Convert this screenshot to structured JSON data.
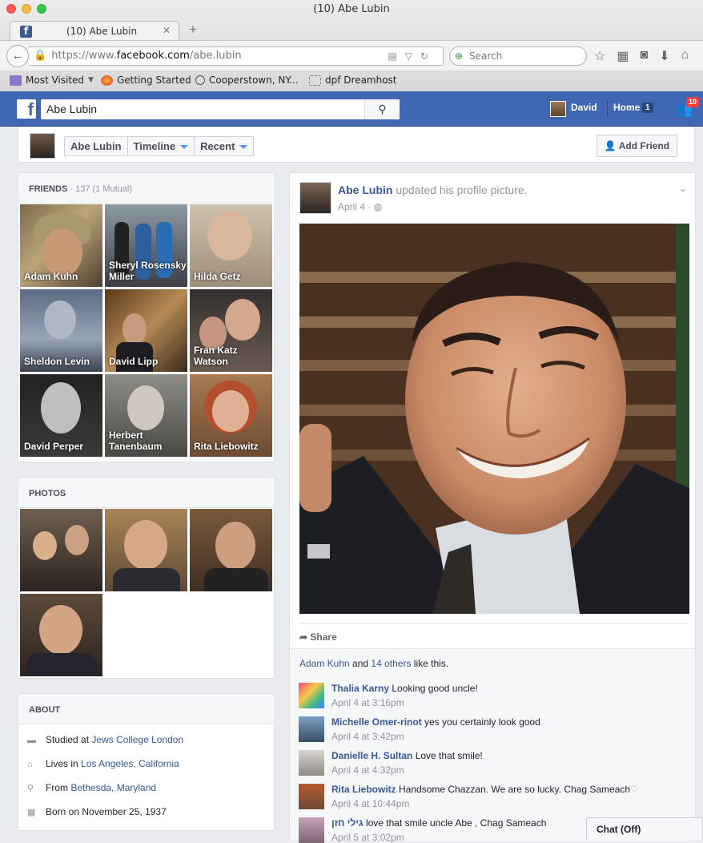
{
  "browser": {
    "window_title": "(10) Abe Lubin",
    "tab_title": "(10) Abe Lubin",
    "url_protocol": "https://www.",
    "url_domain": "facebook.com",
    "url_path": "/abe.lubin",
    "search_placeholder": "Search",
    "bookmarks": [
      "Most Visited",
      "Getting Started",
      "Cooperstown, NY...",
      "dpf Dreamhost"
    ]
  },
  "fb_header": {
    "search_value": "Abe Lubin",
    "user_name": "David",
    "home_label": "Home",
    "home_count": "1",
    "friend_requests_count": "10"
  },
  "profile_bar": {
    "name": "Abe Lubin",
    "timeline": "Timeline",
    "recent": "Recent",
    "add_friend": "Add Friend"
  },
  "friends": {
    "title": "FRIENDS",
    "count": "137 (1 Mutual)",
    "items": [
      {
        "name": "Adam Kuhn"
      },
      {
        "name": "Sheryl Rosensky Miller"
      },
      {
        "name": "Hilda Getz"
      },
      {
        "name": "Sheldon Levin"
      },
      {
        "name": "David Lipp"
      },
      {
        "name": "Fran Katz Watson"
      },
      {
        "name": "David Perper"
      },
      {
        "name": "Herbert Tanenbaum"
      },
      {
        "name": "Rita Liebowitz"
      }
    ]
  },
  "photos": {
    "title": "PHOTOS"
  },
  "about": {
    "title": "ABOUT",
    "studied_prefix": "Studied at ",
    "studied_link": "Jews College London",
    "lives_prefix": "Lives in ",
    "lives_link": "Los Angeles, California",
    "from_prefix": "From ",
    "from_link": "Bethesda, Maryland",
    "born": "Born on November 25, 1937"
  },
  "post": {
    "author": "Abe Lubin",
    "action": "updated his profile picture.",
    "date": "April 4 ·",
    "share_label": "Share",
    "likes_name": "Adam Kuhn",
    "likes_and": " and ",
    "likes_others": "14 others",
    "likes_suffix": " like this.",
    "comments": [
      {
        "author": "Thalia Karny",
        "text": "Looking good uncle!",
        "time": "April 4 at 3:16pm"
      },
      {
        "author": "Michelle Omer-rinot",
        "text": "yes you certainly look good",
        "time": "April 4 at 3:42pm"
      },
      {
        "author": "Danielle H. Sultan",
        "text": "Love that smile!",
        "time": "April 4 at 4:32pm"
      },
      {
        "author": "Rita Liebowitz",
        "text": "Handsome Chazzan. We are so lucky. Chag Sameach",
        "time": "April 4 at 10:44pm"
      },
      {
        "author": "גילי חזן",
        "text": "love that smile uncle Abe , Chag Sameach",
        "time": "April 5 at 3:02pm"
      }
    ]
  },
  "chat": {
    "label": "Chat (Off)"
  },
  "colors": {
    "fb_blue": "#4267b2",
    "link": "#365899",
    "badge_red": "#fa3e3e"
  }
}
